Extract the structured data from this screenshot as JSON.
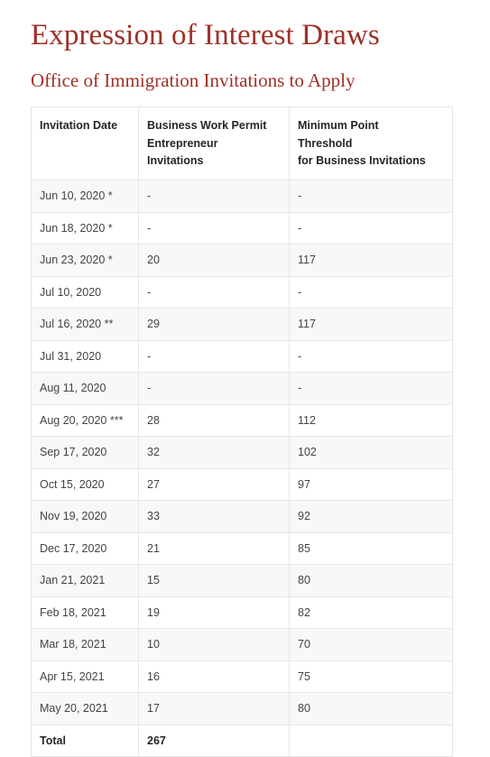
{
  "header": {
    "title": "Expression of Interest Draws",
    "subtitle": "Office of Immigration Invitations to Apply"
  },
  "colors": {
    "heading": "#9e3026",
    "body_text": "#3f4448",
    "border": "#e6e6e6",
    "stripe": "#f8f8f8"
  },
  "table": {
    "columns": [
      "Invitation Date",
      "Business Work Permit Entrepreneur Invitations",
      "Minimum Point Threshold for Business Invitations"
    ],
    "column_lines": [
      [
        "Invitation Date"
      ],
      [
        "Business Work Permit",
        "Entrepreneur",
        "Invitations"
      ],
      [
        "Minimum Point",
        "Threshold",
        "for Business Invitations"
      ]
    ],
    "rows": [
      {
        "date": "Jun 10, 2020 *",
        "invitations": "-",
        "threshold": "-"
      },
      {
        "date": "Jun 18, 2020 *",
        "invitations": "-",
        "threshold": "-"
      },
      {
        "date": "Jun 23, 2020 *",
        "invitations": "20",
        "threshold": "117"
      },
      {
        "date": "Jul 10, 2020",
        "invitations": "-",
        "threshold": "-"
      },
      {
        "date": "Jul 16, 2020 **",
        "invitations": "29",
        "threshold": "117"
      },
      {
        "date": "Jul 31, 2020",
        "invitations": "-",
        "threshold": "-"
      },
      {
        "date": "Aug 11, 2020",
        "invitations": "-",
        "threshold": "-"
      },
      {
        "date": "Aug 20, 2020 ***",
        "invitations": "28",
        "threshold": "112"
      },
      {
        "date": "Sep 17, 2020",
        "invitations": "32",
        "threshold": "102"
      },
      {
        "date": "Oct 15, 2020",
        "invitations": "27",
        "threshold": "97"
      },
      {
        "date": "Nov 19, 2020",
        "invitations": "33",
        "threshold": "92"
      },
      {
        "date": "Dec 17, 2020",
        "invitations": "21",
        "threshold": "85"
      },
      {
        "date": "Jan 21, 2021",
        "invitations": "15",
        "threshold": "80"
      },
      {
        "date": "Feb 18, 2021",
        "invitations": "19",
        "threshold": "82"
      },
      {
        "date": "Mar 18, 2021",
        "invitations": "10",
        "threshold": "70"
      },
      {
        "date": "Apr 15, 2021",
        "invitations": "16",
        "threshold": "75"
      },
      {
        "date": "May 20, 2021",
        "invitations": "17",
        "threshold": "80"
      }
    ],
    "total": {
      "label": "Total",
      "invitations": "267",
      "threshold": ""
    }
  }
}
